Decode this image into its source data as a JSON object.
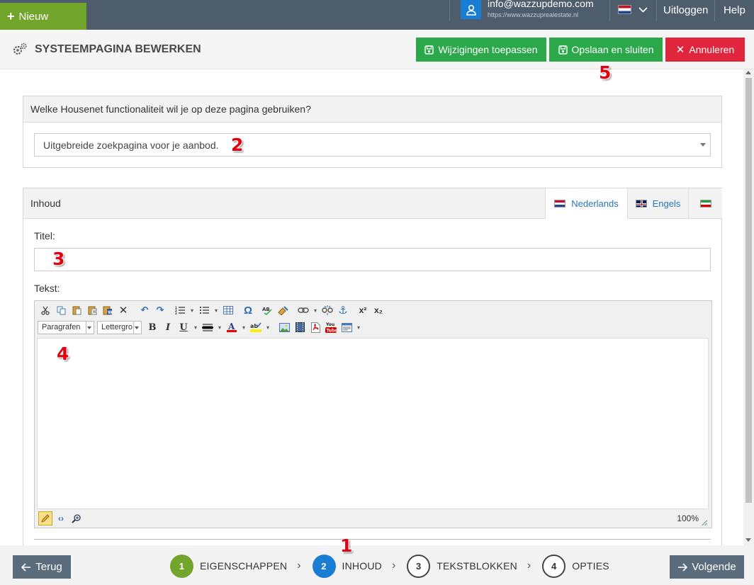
{
  "topbar": {
    "new_label": "Nieuw",
    "user_email": "info@wazzupdemo.com",
    "user_url": "https://www.wazzuprealestate.nl",
    "logout_label": "Uitloggen",
    "help_label": "Help"
  },
  "header": {
    "title": "SYSTEEMPAGINA BEWERKEN",
    "apply_label": "Wijzigingen toepassen",
    "save_close_label": "Opslaan en sluiten",
    "cancel_label": "Annuleren"
  },
  "function_panel": {
    "question": "Welke Housenet functionaliteit wil je op deze pagina gebruiken?",
    "selected_value": "Uitgebreide zoekpagina voor je aanbod."
  },
  "content_panel": {
    "heading": "Inhoud",
    "tabs": [
      {
        "label": "Nederlands",
        "flag": "nl",
        "active": true
      },
      {
        "label": "Engels",
        "flag": "gb",
        "active": false
      },
      {
        "label": "",
        "flag": "ir",
        "active": false
      }
    ],
    "title_label": "Titel:",
    "title_value": "",
    "text_label": "Tekst:",
    "editor": {
      "paragraph_dropdown": "Paragrafen",
      "fontsize_dropdown": "Lettergro",
      "zoom": "100%"
    }
  },
  "annotations": [
    "1",
    "2",
    "3",
    "4",
    "5"
  ],
  "footer": {
    "back_label": "Terug",
    "next_label": "Volgende",
    "steps": [
      {
        "num": "1",
        "label": "EIGENSCHAPPEN",
        "state": "done"
      },
      {
        "num": "2",
        "label": "INHOUD",
        "state": "current"
      },
      {
        "num": "3",
        "label": "TEKSTBLOKKEN",
        "state": "todo"
      },
      {
        "num": "4",
        "label": "OPTIES",
        "state": "todo"
      }
    ]
  },
  "colors": {
    "topbar": "#4e5d6c",
    "new_button": "#71a52c",
    "save_buttons": "#2aa84a",
    "cancel_button": "#e0263c",
    "step_done": "#71a52c",
    "step_current": "#1a7dd4",
    "annotation_marker": "#e3000f"
  }
}
